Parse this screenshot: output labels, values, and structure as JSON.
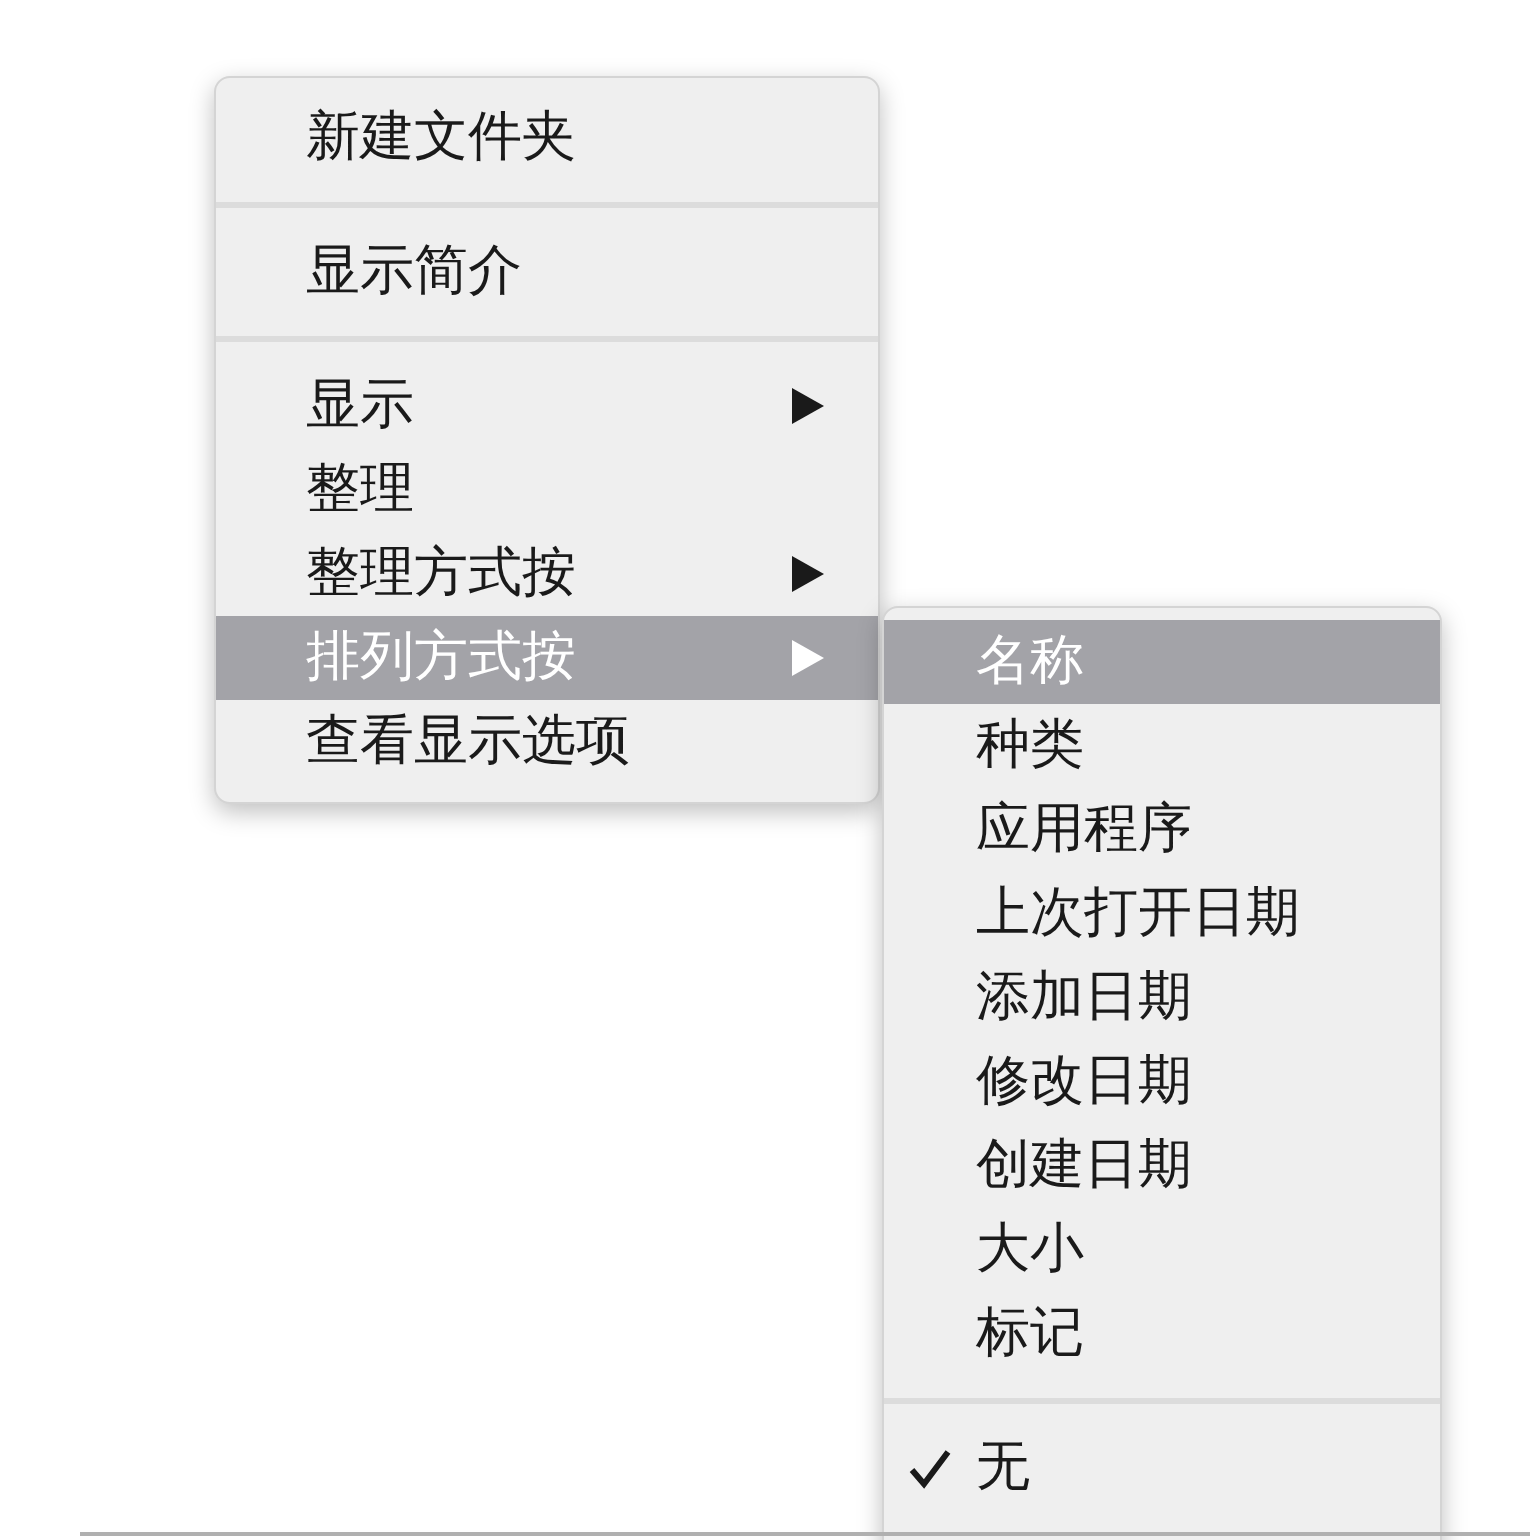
{
  "context_menu": {
    "items": [
      {
        "kind": "item",
        "label": "新建文件夹",
        "has_submenu": false,
        "selected": false
      },
      {
        "kind": "separator"
      },
      {
        "kind": "item",
        "label": "显示简介",
        "has_submenu": false,
        "selected": false
      },
      {
        "kind": "separator"
      },
      {
        "kind": "item",
        "label": "显示",
        "has_submenu": true,
        "selected": false
      },
      {
        "kind": "item",
        "label": "整理",
        "has_submenu": false,
        "selected": false
      },
      {
        "kind": "item",
        "label": "整理方式按",
        "has_submenu": true,
        "selected": false
      },
      {
        "kind": "item",
        "label": "排列方式按",
        "has_submenu": true,
        "selected": true
      },
      {
        "kind": "item",
        "label": "查看显示选项",
        "has_submenu": false,
        "selected": false
      }
    ]
  },
  "submenu": {
    "items": [
      {
        "kind": "item",
        "label": "名称",
        "selected": true,
        "checked": false
      },
      {
        "kind": "item",
        "label": "种类",
        "selected": false,
        "checked": false
      },
      {
        "kind": "item",
        "label": "应用程序",
        "selected": false,
        "checked": false
      },
      {
        "kind": "item",
        "label": "上次打开日期",
        "selected": false,
        "checked": false
      },
      {
        "kind": "item",
        "label": "添加日期",
        "selected": false,
        "checked": false
      },
      {
        "kind": "item",
        "label": "修改日期",
        "selected": false,
        "checked": false
      },
      {
        "kind": "item",
        "label": "创建日期",
        "selected": false,
        "checked": false
      },
      {
        "kind": "item",
        "label": "大小",
        "selected": false,
        "checked": false
      },
      {
        "kind": "item",
        "label": "标记",
        "selected": false,
        "checked": false
      },
      {
        "kind": "separator"
      },
      {
        "kind": "item",
        "label": "无",
        "selected": false,
        "checked": true
      }
    ]
  }
}
